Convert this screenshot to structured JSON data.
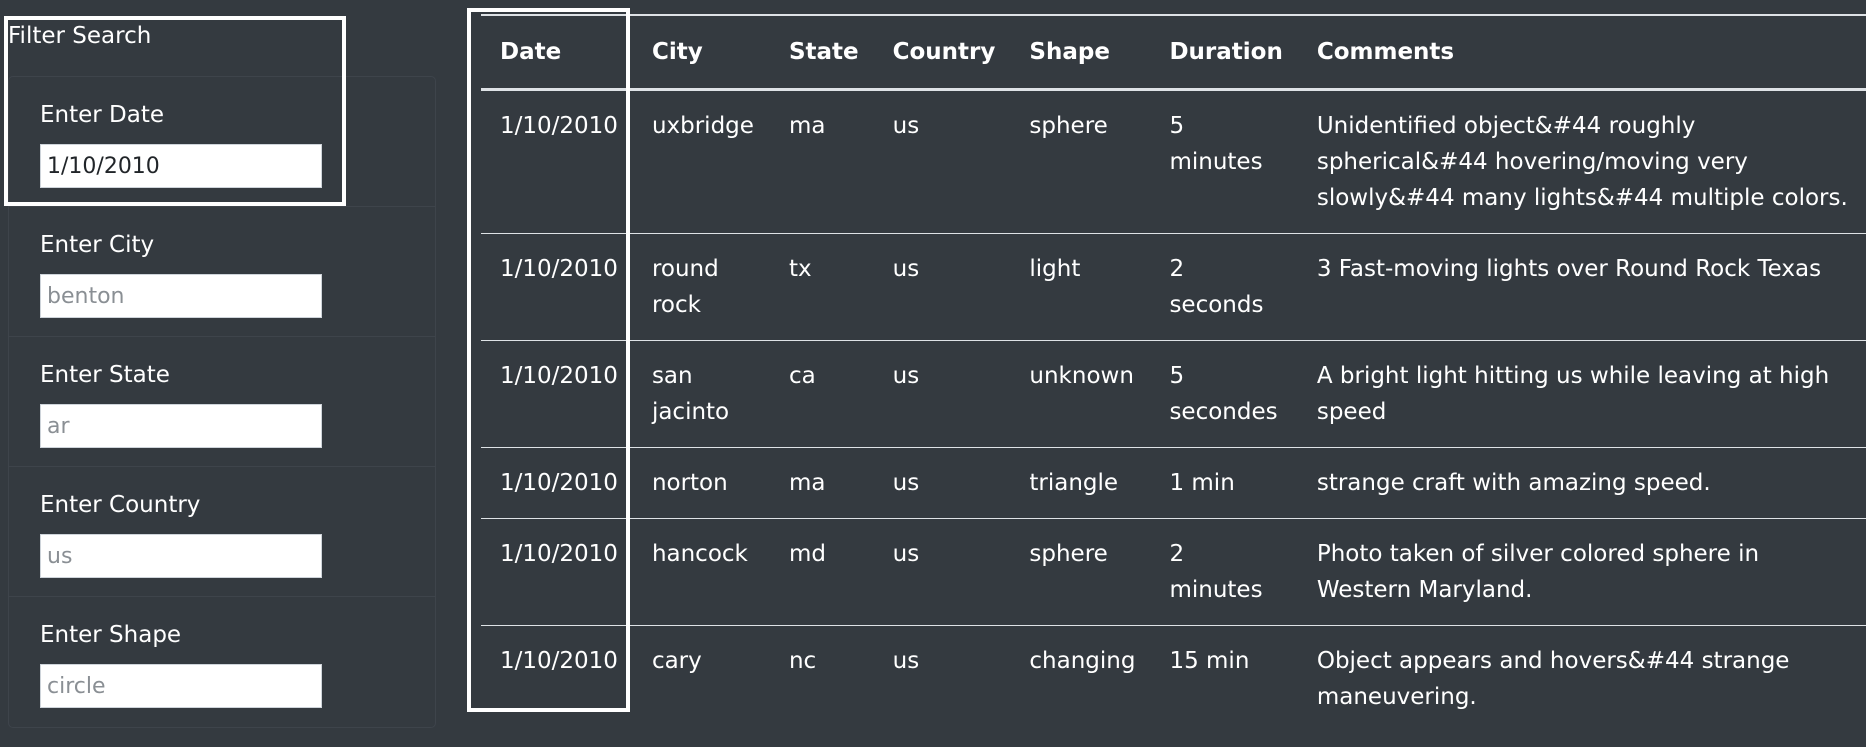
{
  "filter": {
    "title": "Filter Search",
    "fields": [
      {
        "label": "Enter Date",
        "value": "1/10/2010",
        "placeholder": ""
      },
      {
        "label": "Enter City",
        "value": "",
        "placeholder": "benton"
      },
      {
        "label": "Enter State",
        "value": "",
        "placeholder": "ar"
      },
      {
        "label": "Enter Country",
        "value": "",
        "placeholder": "us"
      },
      {
        "label": "Enter Shape",
        "value": "",
        "placeholder": "circle"
      }
    ]
  },
  "table": {
    "headers": [
      "Date",
      "City",
      "State",
      "Country",
      "Shape",
      "Duration",
      "Comments"
    ],
    "rows": [
      [
        "1/10/2010",
        "uxbridge",
        "ma",
        "us",
        "sphere",
        "5 minutes",
        "Unidentified object&#44 roughly spherical&#44 hovering/moving very slowly&#44 many lights&#44 multiple colors."
      ],
      [
        "1/10/2010",
        "round rock",
        "tx",
        "us",
        "light",
        "2 seconds",
        "3 Fast-moving lights over Round Rock Texas"
      ],
      [
        "1/10/2010",
        "san jacinto",
        "ca",
        "us",
        "unknown",
        "5 secondes",
        "A bright light hitting us while leaving at high speed"
      ],
      [
        "1/10/2010",
        "norton",
        "ma",
        "us",
        "triangle",
        "1 min",
        "strange craft with amazing speed."
      ],
      [
        "1/10/2010",
        "hancock",
        "md",
        "us",
        "sphere",
        "2 minutes",
        "Photo taken of silver colored sphere in Western Maryland."
      ],
      [
        "1/10/2010",
        "cary",
        "nc",
        "us",
        "changing",
        "15 min",
        "Object appears and hovers&#44 strange maneuvering."
      ]
    ]
  }
}
